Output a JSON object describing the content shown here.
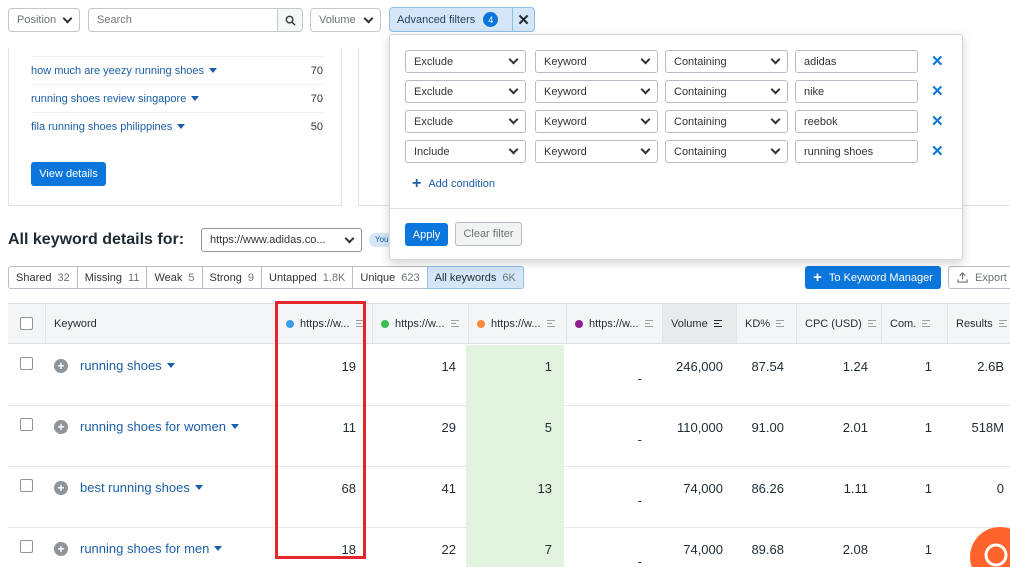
{
  "filter_bar": {
    "position": "Position",
    "search_placeholder": "Search",
    "volume": "Volume",
    "advanced_filters": "Advanced filters",
    "advanced_count": "4"
  },
  "top_keywords": [
    {
      "keyword": "how much are yeezy running shoes",
      "value": "70"
    },
    {
      "keyword": "running shoes review singapore",
      "value": "70"
    },
    {
      "keyword": "fila running shoes philippines",
      "value": "50"
    }
  ],
  "view_details": "View details",
  "advanced_popup": {
    "conditions": [
      {
        "mode": "Exclude",
        "field": "Keyword",
        "operator": "Containing",
        "value": "adidas"
      },
      {
        "mode": "Exclude",
        "field": "Keyword",
        "operator": "Containing",
        "value": "nike"
      },
      {
        "mode": "Exclude",
        "field": "Keyword",
        "operator": "Containing",
        "value": "reebok"
      },
      {
        "mode": "Include",
        "field": "Keyword",
        "operator": "Containing",
        "value": "running shoes"
      }
    ],
    "add_condition": "Add condition",
    "apply": "Apply",
    "clear": "Clear filter"
  },
  "section": {
    "title": "All keyword details for:",
    "domain": "https://www.adidas.co...",
    "you_tag": "You"
  },
  "tabs": [
    {
      "label": "Shared",
      "count": "32"
    },
    {
      "label": "Missing",
      "count": "11"
    },
    {
      "label": "Weak",
      "count": "5"
    },
    {
      "label": "Strong",
      "count": "9"
    },
    {
      "label": "Untapped",
      "count": "1.8K"
    },
    {
      "label": "Unique",
      "count": "623"
    },
    {
      "label": "All keywords",
      "count": "6K"
    }
  ],
  "actions": {
    "keyword_manager": "To Keyword Manager",
    "export": "Export"
  },
  "table": {
    "headers": {
      "keyword": "Keyword",
      "d1": "https://w...",
      "d2": "https://w...",
      "d3": "https://w...",
      "d4": "https://w...",
      "volume": "Volume",
      "kd": "KD%",
      "cpc": "CPC (USD)",
      "com": "Com.",
      "results": "Results"
    },
    "rows": [
      {
        "keyword": "running shoes",
        "d1": "19",
        "d2": "14",
        "d3": "1",
        "d4": "-",
        "volume": "246,000",
        "kd": "87.54",
        "cpc": "1.24",
        "com": "1",
        "results": "2.6B"
      },
      {
        "keyword": "running shoes for women",
        "d1": "11",
        "d2": "29",
        "d3": "5",
        "d4": "-",
        "volume": "110,000",
        "kd": "91.00",
        "cpc": "2.01",
        "com": "1",
        "results": "518M"
      },
      {
        "keyword": "best running shoes",
        "d1": "68",
        "d2": "41",
        "d3": "13",
        "d4": "-",
        "volume": "74,000",
        "kd": "86.26",
        "cpc": "1.11",
        "com": "1",
        "results": "0"
      },
      {
        "keyword": "running shoes for men",
        "d1": "18",
        "d2": "22",
        "d3": "7",
        "d4": "-",
        "volume": "74,000",
        "kd": "89.68",
        "cpc": "2.08",
        "com": "1",
        "results": "1"
      }
    ]
  },
  "colors": {
    "accent": "#0b76db",
    "domain1": "#3a9ee8",
    "domain2": "#3cba54",
    "domain3": "#ff8a3d",
    "domain4": "#8e1e8e",
    "highlight_box": "#e3262b",
    "highlight_column": "#e1f3df"
  }
}
